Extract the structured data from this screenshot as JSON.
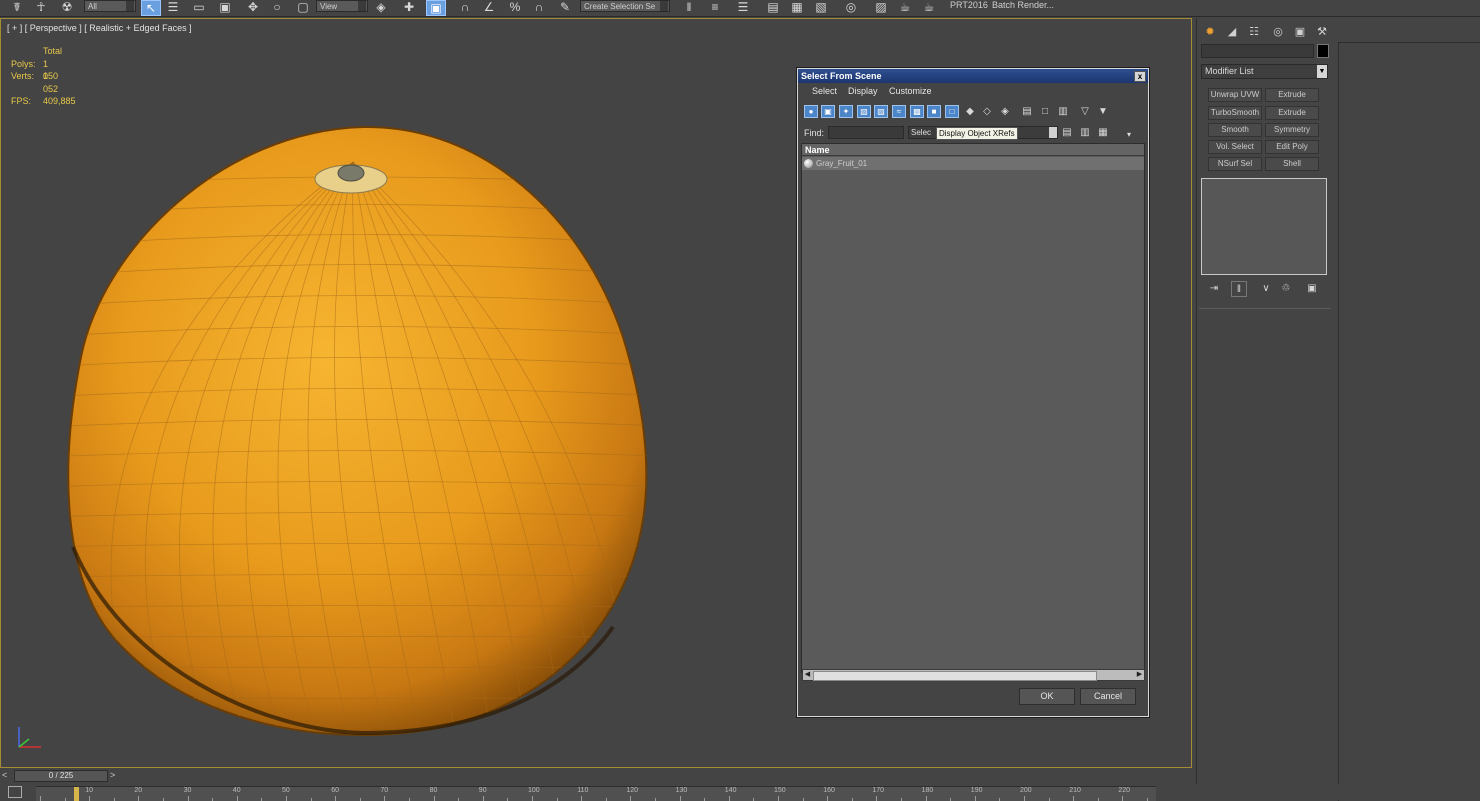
{
  "toolbar": {
    "selection_filter": "All",
    "ref_coord": "View",
    "selection_set": "Create Selection Se",
    "prt_label": "PRT2016",
    "batch_render_label": "Batch Render..."
  },
  "viewport": {
    "label": "[ + ] [ Perspective ] [ Realistic + Edged Faces ]",
    "stats": {
      "total_label": "Total",
      "polys_label": "Polys:",
      "polys_value": "1 050",
      "verts_label": "Verts:",
      "verts_value": "1 052",
      "fps_label": "FPS:",
      "fps_value": "409,885"
    }
  },
  "dialog": {
    "title": "Select From Scene",
    "close_glyph": "x",
    "menu": [
      "Select",
      "Display",
      "Customize"
    ],
    "find_label": "Find:",
    "find_value": "",
    "selection_set_text": "Selec",
    "tooltip": "Display Object XRefs",
    "column_name": "Name",
    "rows": [
      {
        "name": "Gray_Fruit_01"
      }
    ],
    "ok_label": "OK",
    "cancel_label": "Cancel"
  },
  "command_panel": {
    "modifier_list": "Modifier List",
    "modifier_buttons": [
      "Unwrap UVW",
      "Extrude",
      "TurboSmooth",
      "Extrude",
      "Smooth",
      "Symmetry",
      "Vol. Select",
      "Edit Poly",
      "NSurf Sel",
      "Shell"
    ]
  },
  "timeline": {
    "frame_display": "0 / 225",
    "ruler_numbers": [
      "10",
      "20",
      "30",
      "40",
      "50",
      "60",
      "70",
      "80",
      "90",
      "100",
      "110",
      "120",
      "130",
      "140",
      "150",
      "160",
      "170",
      "180",
      "190",
      "200",
      "210",
      "220"
    ]
  },
  "colors": {
    "viewport_border": "#a58c32",
    "stats_text": "#e8c84a",
    "dialog_title_bg": "#1c3570",
    "fruit_orange": "#e8a020"
  }
}
